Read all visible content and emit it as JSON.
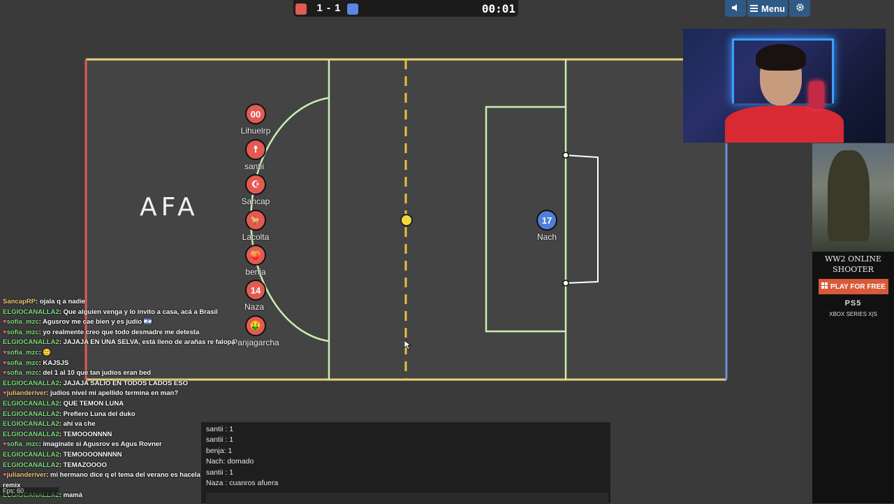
{
  "scorebar": {
    "score": "1 - 1",
    "time": "00:01",
    "red_color": "#e35a52",
    "blue_color": "#5b86e5"
  },
  "topbar": {
    "sound_icon": "speaker-icon",
    "menu_label": "Menu",
    "settings_icon": "gear-icon"
  },
  "field": {
    "logo_text": "AFA",
    "colors": {
      "grass": "#444444",
      "border": "#e8d37a",
      "goal_red": "#e35a52",
      "goal_blue": "#6a8fe0",
      "lines": "#c8f0b0"
    }
  },
  "red_players": [
    {
      "number": "00",
      "name": "Lihuelrp"
    },
    {
      "number": "☨",
      "name": "santii"
    },
    {
      "number": "☪",
      "name": "Sancap"
    },
    {
      "number": "🐎",
      "name": "Lacolta"
    },
    {
      "number": "🍑",
      "name": "benja"
    },
    {
      "number": "14",
      "name": "Naza"
    },
    {
      "number": "🤑",
      "name": "Panjagarcha"
    }
  ],
  "blue_players": [
    {
      "number": "17",
      "name": "Nach"
    }
  ],
  "ad": {
    "title": "WW2 ONLINE SHOOTER",
    "button": "PLAY FOR FREE",
    "ps5": "PS5",
    "xbox": "XBOX SERIES X|S"
  },
  "chatlog": [
    {
      "user": "SancapRP",
      "msg": "ojala q a nadie",
      "cls": "cu-sanc",
      "heart": false
    },
    {
      "user": "ELGIOCANALLA2",
      "msg": "Que alguien venga y lo invito a casa, acá a Brasil",
      "cls": "cu-elg",
      "heart": false
    },
    {
      "user": "sofia_mzc",
      "msg": "Agusrov me cae bien y es judío 🇮🇱",
      "cls": "cu-sofia",
      "heart": true
    },
    {
      "user": "sofia_mzc",
      "msg": "yo realmente creo que todo desmadre me detesta",
      "cls": "cu-sofia",
      "heart": true
    },
    {
      "user": "ELGIOCANALLA2",
      "msg": "JAJAJA EN UNA SELVA, está lleno de arañas re falopa",
      "cls": "cu-elg",
      "heart": false
    },
    {
      "user": "sofia_mzc",
      "msg": "🙂",
      "cls": "cu-sofia",
      "heart": true
    },
    {
      "user": "sofia_mzc",
      "msg": "KAJSJS",
      "cls": "cu-sofia",
      "heart": true
    },
    {
      "user": "sofia_mzc",
      "msg": "del 1 al 10 que tan judíos eran bed",
      "cls": "cu-sofia",
      "heart": true
    },
    {
      "user": "ELGIOCANALLA2",
      "msg": "JAJAJA SALIO EN TODOS LADOS ESO",
      "cls": "cu-elg",
      "heart": false
    },
    {
      "user": "julianderiver",
      "msg": "judios nivel mi apellido termina en man?",
      "cls": "cu-jul",
      "heart": true
    },
    {
      "user": "ELGIOCANALLA2",
      "msg": "QUE TEMON LUNA",
      "cls": "cu-elg",
      "heart": false
    },
    {
      "user": "ELGIOCANALLA2",
      "msg": "Prefiero Luna del duko",
      "cls": "cu-elg",
      "heart": false
    },
    {
      "user": "ELGIOCANALLA2",
      "msg": "ahí va che",
      "cls": "cu-elg",
      "heart": false
    },
    {
      "user": "ELGIOCANALLA2",
      "msg": "TEMOOONNNN",
      "cls": "cu-elg",
      "heart": false
    },
    {
      "user": "sofia_mzc",
      "msg": "imagínate si Agusrov es Agus Rovner",
      "cls": "cu-sofia",
      "heart": true
    },
    {
      "user": "ELGIOCANALLA2",
      "msg": "TEMOOOONNNNN",
      "cls": "cu-elg",
      "heart": false
    },
    {
      "user": "ELGIOCANALLA2",
      "msg": "TEMAZOOOO",
      "cls": "cu-elg",
      "heart": false
    },
    {
      "user": "julianderiver",
      "msg": "mi hermano dice q el tema del verano es hacela corta morocha",
      "cls": "cu-jul",
      "heart": true
    },
    {
      "user": "",
      "msg": "remix",
      "cls": "cu-elg",
      "heart": false
    },
    {
      "user": "ELGIOCANALLA2",
      "msg": "mamá",
      "cls": "cu-elg",
      "heart": false
    }
  ],
  "fps_label": "Fps: 60",
  "gamechat": [
    "santii : 1",
    "santii : 1",
    "benja: 1",
    "Nach: domado",
    "santii : 1",
    "Naza : cuanros afuera"
  ],
  "gamechat_input": ""
}
